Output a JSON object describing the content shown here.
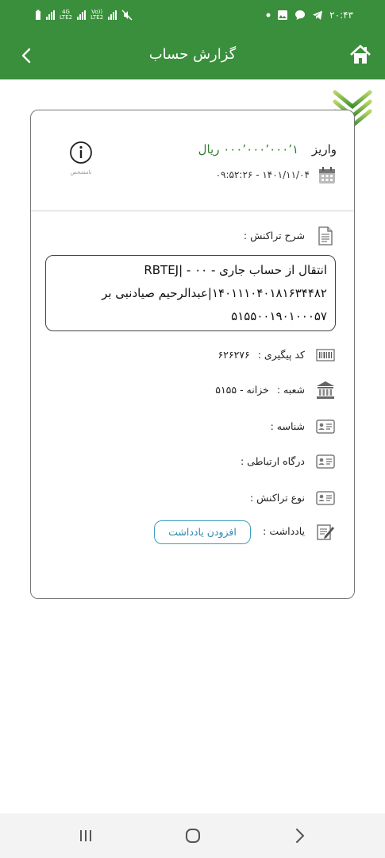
{
  "status_bar": {
    "time": "۲۰:۴۳",
    "network_1": "4G",
    "network_1_sub": "LTE2",
    "network_2": "Vo))",
    "network_2_sub": "LTE2"
  },
  "toolbar": {
    "title": "گزارش حساب"
  },
  "transaction": {
    "type": "واریز",
    "amount": "۰۰۰٬۰۰۰٬۰۰۰٬۱ ریال",
    "datetime": "۱۴۰۱/۱۱/۰۴ - ۰۹:۵۲:۲۶",
    "info_caption": "نامشخص"
  },
  "details": {
    "description_label": "شرح تراکنش :",
    "description_text": "انتقال از حساب جاری - ۰۰ - RBTEJ| ۱۴۰۱۱۱۰۴۰۱۸۱۶۳۴۴۸۲|عبدالرحیم صیادنبی بر ۵۱۵۵۰۰۱۹۰۱۰۰۰۵۷",
    "tracking_label": "کد پیگیری :",
    "tracking_value": "۶۲۶۲۷۶",
    "branch_label": "شعبه :",
    "branch_value": "خزانه - ۵۱۵۵",
    "id_label": "شناسه :",
    "gateway_label": "درگاه ارتباطی :",
    "trx_type_label": "نوع تراکنش :",
    "note_label": "یادداشت :",
    "add_note_button": "افزودن یادداشت"
  },
  "colors": {
    "brand_green": "#3a8f3c",
    "amount_green": "#2e7d32",
    "link_blue": "#2b88b0"
  },
  "icons": [
    "home-icon",
    "back-chevron-icon",
    "info-icon",
    "calendar-icon",
    "document-icon",
    "barcode-icon",
    "bank-icon",
    "id-card-icon",
    "note-edit-icon",
    "scroll-chevrons-icon"
  ]
}
